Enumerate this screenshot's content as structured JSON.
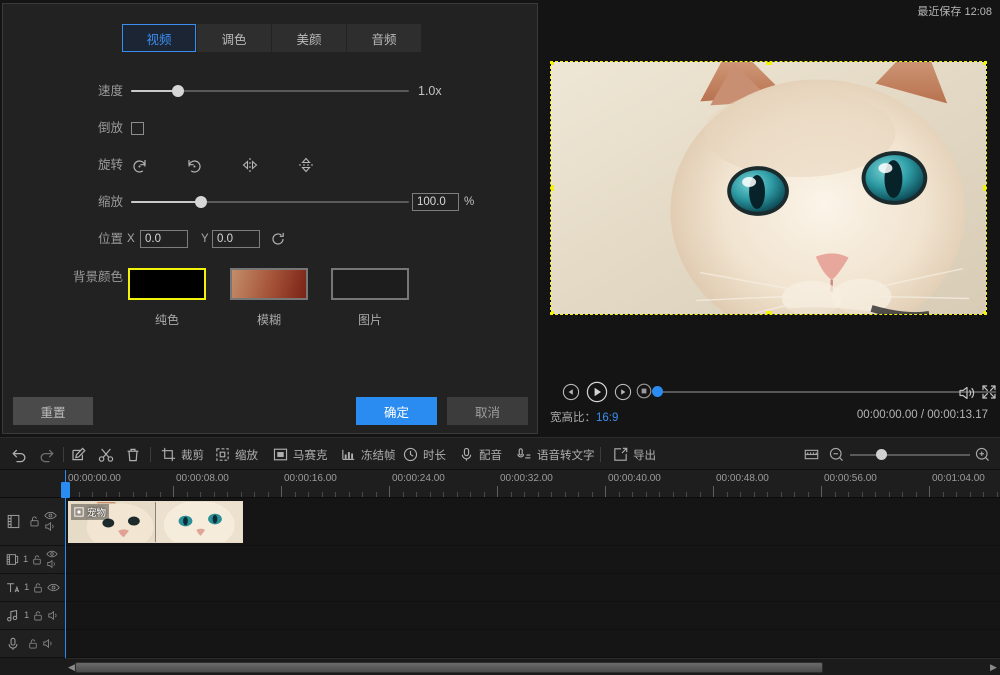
{
  "header": {
    "saved_label": "最近保存 12:08"
  },
  "dialog": {
    "tabs": [
      {
        "label": "视频",
        "active": true
      },
      {
        "label": "调色",
        "active": false
      },
      {
        "label": "美颜",
        "active": false
      },
      {
        "label": "音频",
        "active": false
      }
    ],
    "speed": {
      "label": "速度",
      "value": "1.0x",
      "percent": 17
    },
    "reverse": {
      "label": "倒放",
      "checked": false
    },
    "rotate": {
      "label": "旋转",
      "buttons": [
        "rotate-ccw",
        "rotate-cw",
        "flip-horizontal",
        "flip-vertical"
      ]
    },
    "scale": {
      "label": "缩放",
      "value": "100.0",
      "unit": "%",
      "percent": 25
    },
    "position": {
      "label": "位置",
      "x_label": "X",
      "x_value": "0.0",
      "y_label": "Y",
      "y_value": "0.0"
    },
    "background": {
      "label": "背景颜色",
      "options": [
        {
          "caption": "纯色",
          "selected": true,
          "style": "solid"
        },
        {
          "caption": "模糊",
          "selected": false,
          "style": "blur"
        },
        {
          "caption": "图片",
          "selected": false,
          "style": "image"
        }
      ]
    },
    "buttons": {
      "reset": "重置",
      "ok": "确定",
      "cancel": "取消"
    }
  },
  "preview": {
    "ratio_label": "宽高比：",
    "ratio_value": "16:9",
    "time_current": "00:00:00.00",
    "time_total": "00:00:13.17",
    "time_display": "00:00:00.00 / 00:00:13.17",
    "seek_percent": 0
  },
  "toolbar": {
    "items": [
      {
        "icon": "undo-icon",
        "label": ""
      },
      {
        "icon": "redo-icon",
        "label": ""
      },
      {
        "icon": "edit-icon",
        "label": ""
      },
      {
        "icon": "scissors-icon",
        "label": ""
      },
      {
        "icon": "trash-icon",
        "label": ""
      },
      {
        "icon": "crop-icon",
        "label": "裁剪"
      },
      {
        "icon": "scale-icon",
        "label": "缩放"
      },
      {
        "icon": "mosaic-icon",
        "label": "马赛克"
      },
      {
        "icon": "freeze-frame-icon",
        "label": "冻结帧"
      },
      {
        "icon": "clock-icon",
        "label": "时长"
      },
      {
        "icon": "mic-icon",
        "label": "配音"
      },
      {
        "icon": "speech-to-text-icon",
        "label": "语音转文字"
      },
      {
        "icon": "export-icon",
        "label": "导出"
      }
    ],
    "fit_icon": "fit-to-window-icon",
    "zoom_out_icon": "zoom-out-icon",
    "zoom_in_icon": "zoom-in-icon",
    "zoom_percent": 22
  },
  "timeline": {
    "ruler_labels": [
      "00:00:00.00",
      "00:00:08.00",
      "00:00:16.00",
      "00:00:24.00",
      "00:00:32.00",
      "00:00:40.00",
      "00:00:48.00",
      "00:00:56.00",
      "00:01:04.00"
    ],
    "tracks": [
      {
        "icon": "video-track-icon",
        "num": "",
        "lock": "unlock-icon",
        "eye": "eye-icon",
        "speaker": "speaker-icon"
      },
      {
        "icon": "overlay-track-icon",
        "num": "1",
        "lock": "unlock-icon",
        "eye": "eye-icon",
        "speaker": "speaker-icon"
      },
      {
        "icon": "text-track-icon",
        "num": "1",
        "lock": "unlock-icon",
        "eye": "eye-icon",
        "speaker": ""
      },
      {
        "icon": "music-track-icon",
        "num": "1",
        "lock": "unlock-icon",
        "eye": "",
        "speaker": "speaker-icon"
      },
      {
        "icon": "voiceover-track-icon",
        "num": "",
        "lock": "unlock-icon",
        "eye": "",
        "speaker": "speaker-icon"
      }
    ],
    "clip": {
      "name": "宠物",
      "badge_icon": "video-clip-icon"
    }
  },
  "colors": {
    "accent": "#2a8cf0",
    "selection": "#f2f20a",
    "panel_bg": "#222222",
    "app_bg": "#141414"
  }
}
